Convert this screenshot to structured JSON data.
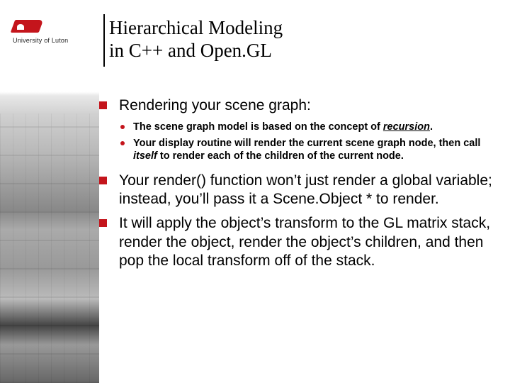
{
  "logo": {
    "caption": "University of Luton"
  },
  "title": {
    "line1": "Hierarchical Modeling",
    "line2": "in C++ and Open.GL"
  },
  "bullets": {
    "b1": {
      "text": "Rendering your scene graph:",
      "subs": {
        "s1_pre": "The scene graph model is based on the concept of ",
        "s1_em": "recursion",
        "s1_post": ".",
        "s2_pre": "Your display routine will render the current scene graph node, then call ",
        "s2_em": "itself",
        "s2_post": " to render each of the children of the current node."
      }
    },
    "b2": {
      "text": "Your render() function won’t just render a global variable; instead, you’ll pass it a Scene.Object * to render."
    },
    "b3": {
      "text": "It will apply the object’s transform to the GL matrix stack, render the object, render the object’s children, and then pop the local transform off of the stack."
    }
  }
}
